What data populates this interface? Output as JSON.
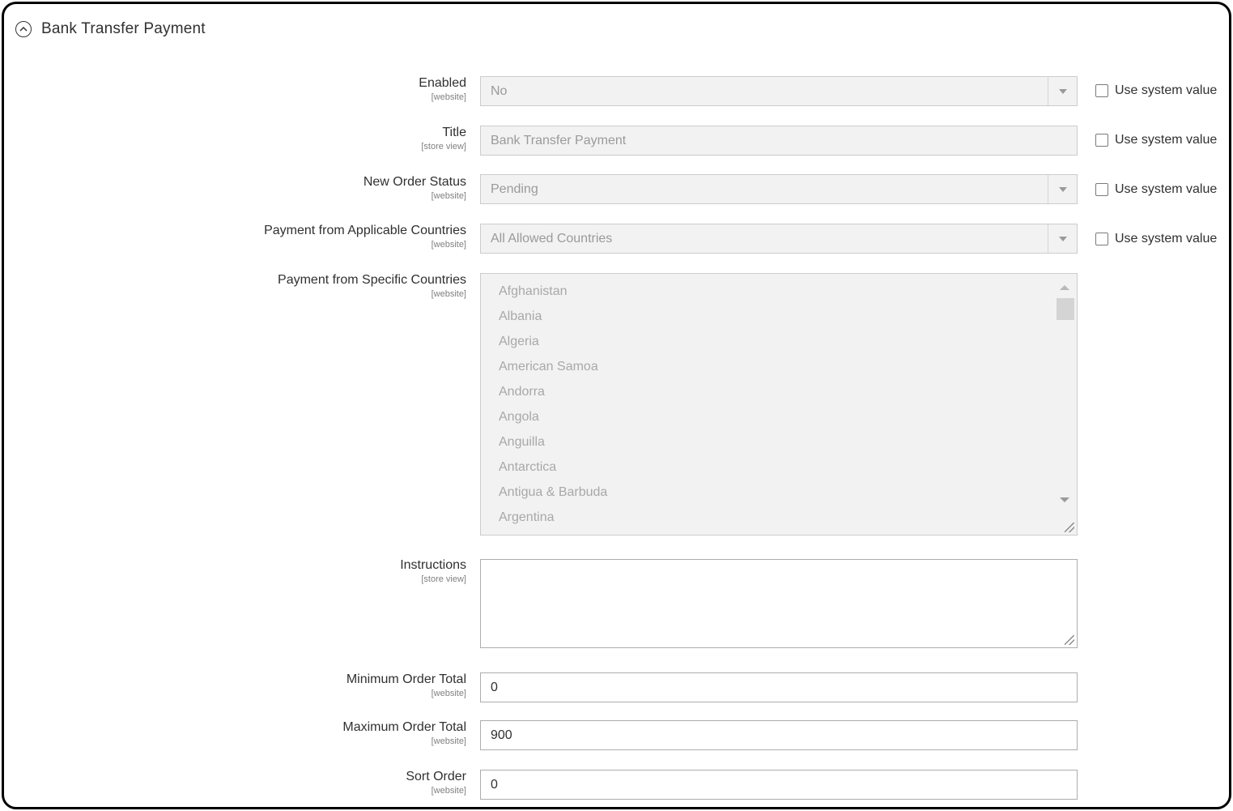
{
  "section": {
    "title": "Bank Transfer Payment"
  },
  "use_system_value_label": "Use system value",
  "fields": {
    "enabled": {
      "label": "Enabled",
      "scope": "[website]",
      "value": "No"
    },
    "title": {
      "label": "Title",
      "scope": "[store view]",
      "value": "Bank Transfer Payment"
    },
    "new_order_status": {
      "label": "New Order Status",
      "scope": "[website]",
      "value": "Pending"
    },
    "applicable_countries": {
      "label": "Payment from Applicable Countries",
      "scope": "[website]",
      "value": "All Allowed Countries"
    },
    "specific_countries": {
      "label": "Payment from Specific Countries",
      "scope": "[website]",
      "options": [
        "Afghanistan",
        "Albania",
        "Algeria",
        "American Samoa",
        "Andorra",
        "Angola",
        "Anguilla",
        "Antarctica",
        "Antigua & Barbuda",
        "Argentina"
      ]
    },
    "instructions": {
      "label": "Instructions",
      "scope": "[store view]",
      "value": ""
    },
    "min_order_total": {
      "label": "Minimum Order Total",
      "scope": "[website]",
      "value": "0"
    },
    "max_order_total": {
      "label": "Maximum Order Total",
      "scope": "[website]",
      "value": "900"
    },
    "sort_order": {
      "label": "Sort Order",
      "scope": "[website]",
      "value": "0"
    }
  },
  "icons": {
    "collapse": "chevron-up-circle-icon",
    "select_arrow": "chevron-down-icon",
    "scroll_up": "arrow-up-icon",
    "scroll_down": "arrow-down-icon",
    "resize": "resize-grip-icon"
  },
  "colors": {
    "disabled_bg": "#f2f2f2",
    "border": "#cccccc",
    "text": "#303030",
    "disabled_text": "#9a9a9a"
  }
}
